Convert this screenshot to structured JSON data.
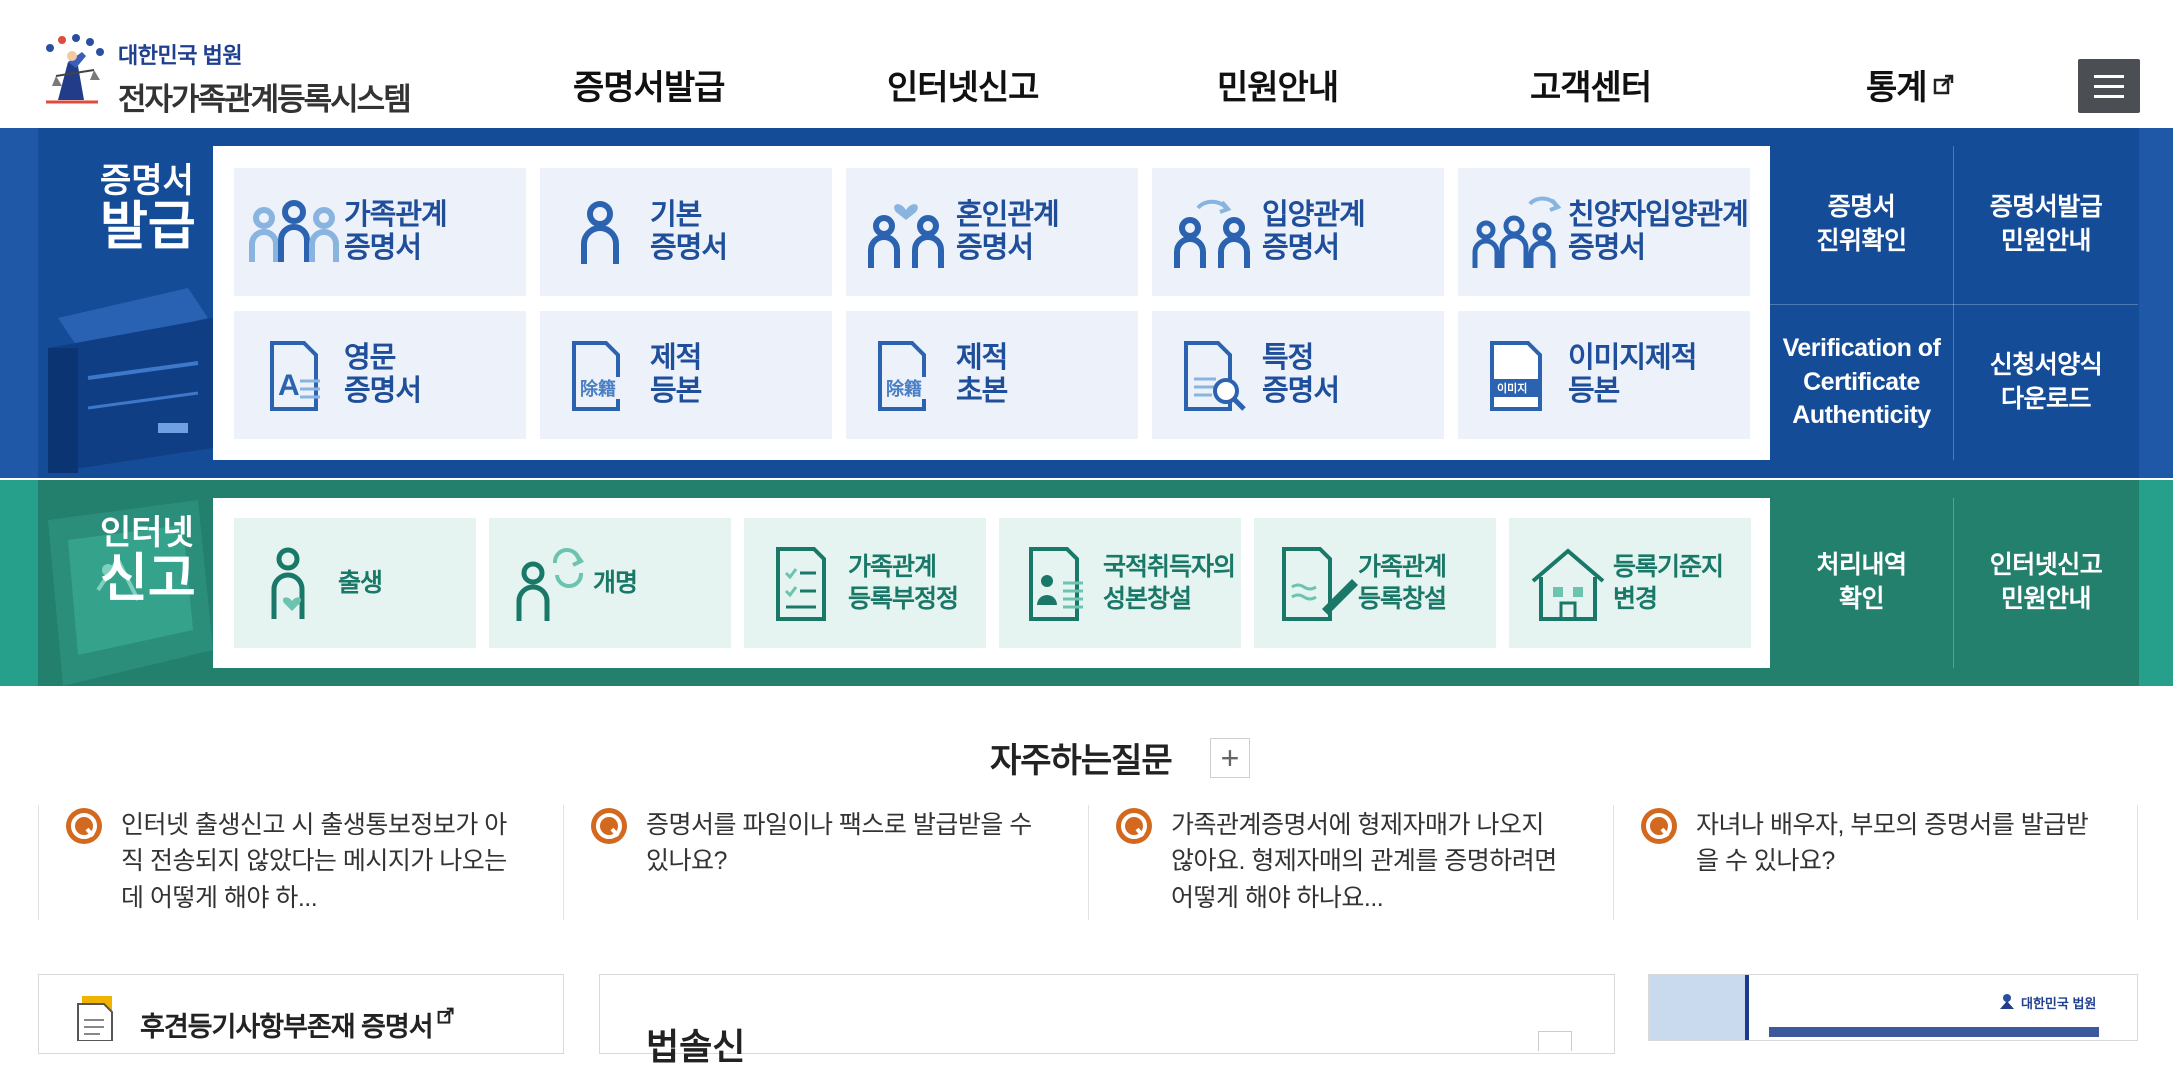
{
  "header": {
    "logo_sub": "대한민국 법원",
    "logo_main": "전자가족관계등록시스템",
    "nav": [
      {
        "label": "증명서발급"
      },
      {
        "label": "인터넷신고"
      },
      {
        "label": "민원안내"
      },
      {
        "label": "고객센터"
      },
      {
        "label": "통계",
        "external": true
      }
    ]
  },
  "certificates": {
    "heading_line1": "증명서",
    "heading_line2": "발급",
    "tiles": [
      {
        "label": "가족관계\n증명서",
        "icon": "family-icon"
      },
      {
        "label": "기본\n증명서",
        "icon": "person-icon"
      },
      {
        "label": "혼인관계\n증명서",
        "icon": "couple-heart-icon"
      },
      {
        "label": "입양관계\n증명서",
        "icon": "adoption-icon"
      },
      {
        "label": "친양자입양관계\n증명서",
        "icon": "family-adoption-icon"
      },
      {
        "label": "영문\n증명서",
        "icon": "english-doc-icon"
      },
      {
        "label": "제적\n등본",
        "icon": "removed-register-icon"
      },
      {
        "label": "제적\n초본",
        "icon": "removed-register-abstract-icon"
      },
      {
        "label": "특정\n증명서",
        "icon": "doc-search-icon"
      },
      {
        "label": "이미지제적\n등본",
        "icon": "image-register-icon"
      }
    ],
    "side_links": [
      {
        "label": "증명서\n진위확인"
      },
      {
        "label": "증명서발급\n민원안내"
      },
      {
        "label": "Verification of\nCertificate\nAuthenticity"
      },
      {
        "label": "신청서양식\n다운로드"
      }
    ],
    "tile_text_tiny": {
      "image": "이미지",
      "removed": "除籍"
    }
  },
  "internet": {
    "heading_line1": "인터넷",
    "heading_line2": "신고",
    "tiles": [
      {
        "label": "출생",
        "icon": "birth-icon"
      },
      {
        "label": "개명",
        "icon": "rename-icon"
      },
      {
        "label": "가족관계\n등록부정정",
        "icon": "checklist-doc-icon"
      },
      {
        "label": "국적취득자의\n성본창설",
        "icon": "id-doc-icon"
      },
      {
        "label": "가족관계\n등록창설",
        "icon": "doc-pen-icon"
      },
      {
        "label": "등록기준지\n변경",
        "icon": "house-icon"
      }
    ],
    "side_links": [
      {
        "label": "처리내역\n확인"
      },
      {
        "label": "인터넷신고\n민원안내"
      }
    ]
  },
  "faq": {
    "title": "자주하는질문",
    "more": "+",
    "q_mark": "Q",
    "items": [
      {
        "text": "인터넷 출생신고 시 출생통보정보가 아직 전송되지 않았다는 메시지가 나오는데 어떻게 해야 하..."
      },
      {
        "text": "증명서를 파일이나 팩스로 발급받을 수 있나요?"
      },
      {
        "text": "가족관계증명서에 형제자매가 나오지 않아요. 형제자매의 관계를 증명하려면 어떻게 해야 하나요..."
      },
      {
        "text": "자녀나 배우자, 부모의 증명서를 발급받을 수 있나요?"
      }
    ]
  },
  "bottom": {
    "box1_title": "후견등기사항부존재 증명서",
    "box2_title": "법솔신",
    "banner_text": "대한민국 법원"
  },
  "colors": {
    "cert_band": "#154c98",
    "internet_band": "#22806d",
    "cert_tile_bg": "#edf2fa",
    "internet_tile_bg": "#e5f4f0",
    "faq_q": "#d2691e"
  }
}
